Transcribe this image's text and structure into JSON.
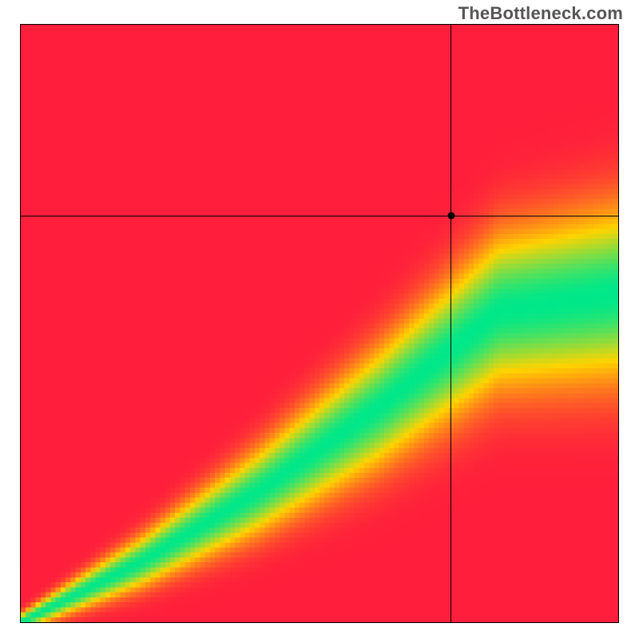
{
  "watermark": "TheBottleneck.com",
  "chart_data": {
    "type": "heatmap",
    "title": "",
    "xlabel": "",
    "ylabel": "",
    "xlim": [
      0,
      100
    ],
    "ylim": [
      0,
      100
    ],
    "grid": false,
    "crosshair": {
      "x": 72,
      "y": 68
    },
    "marker": {
      "x": 72,
      "y": 68
    },
    "colorscale_description": "red (low match) → yellow → green (ideal) along a diagonal ridge; ridge slope indicates GPU-heavy balance area toward lower-right",
    "ridge": {
      "description": "Green band where GPU and CPU are balanced; in this view the ideal band lies below the main diagonal (GPU-bound scenario).",
      "points_x": [
        0,
        20,
        40,
        60,
        80,
        100
      ],
      "points_y_center": [
        0,
        10,
        22,
        36,
        52,
        55
      ],
      "band_halfwidth": [
        1,
        3,
        5,
        7,
        9,
        10
      ]
    },
    "colors": {
      "low": "#FF1E3C",
      "mid": "#FFD400",
      "high": "#00E88A"
    }
  }
}
